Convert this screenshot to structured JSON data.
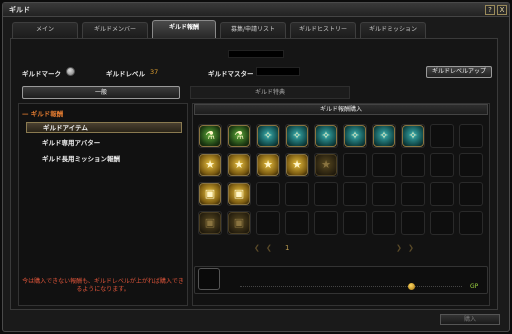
{
  "window": {
    "title": "ギルド",
    "help_label": "?",
    "close_label": "X"
  },
  "tabs": [
    {
      "label": "メイン"
    },
    {
      "label": "ギルドメンバー"
    },
    {
      "label": "ギルド報酬"
    },
    {
      "label": "募集/申請リスト"
    },
    {
      "label": "ギルドヒストリー"
    },
    {
      "label": "ギルドミッション"
    }
  ],
  "info": {
    "mark_label": "ギルドマーク",
    "level_label": "ギルドレベル",
    "level_value": "37",
    "master_label": "ギルドマスター",
    "levelup_button": "ギルドレベルアップ"
  },
  "subtabs": {
    "general": "一般",
    "special": "ギルド特典"
  },
  "tree": {
    "header": "ギルド報酬",
    "items": [
      {
        "label": "ギルドアイテム"
      },
      {
        "label": "ギルド専用アバター"
      },
      {
        "label": "ギルド長用ミッション報酬"
      }
    ]
  },
  "shop": {
    "header": "ギルド報酬購入",
    "rows": [
      [
        "green-potion-icon",
        "green-star-potion-icon",
        "cyan-scroll-icon",
        "cyan-scroll-icon",
        "cyan-scroll-icon",
        "cyan-scroll-icon",
        "cyan-scroll-icon",
        "cyan-scroll-icon"
      ],
      [
        "gold-star-card-icon",
        "gold-star-card-icon",
        "gold-star-card-icon",
        "gold-star-card-icon",
        "dim-star-card-icon"
      ],
      [
        "gold-ticket-icon",
        "gold-ticket-icon"
      ],
      [
        "dim-ticket-icon",
        "dim-ticket-icon"
      ]
    ],
    "page": "1"
  },
  "warning": "今は購入できない報酬も、ギルドレベルが上がれば購入できるようになります。",
  "currency": "GP",
  "buy_button": "購入",
  "colors": {
    "accent": "#e07a30",
    "level": "#e0a030",
    "warning": "#e0553a",
    "gp": "#9ad040"
  }
}
